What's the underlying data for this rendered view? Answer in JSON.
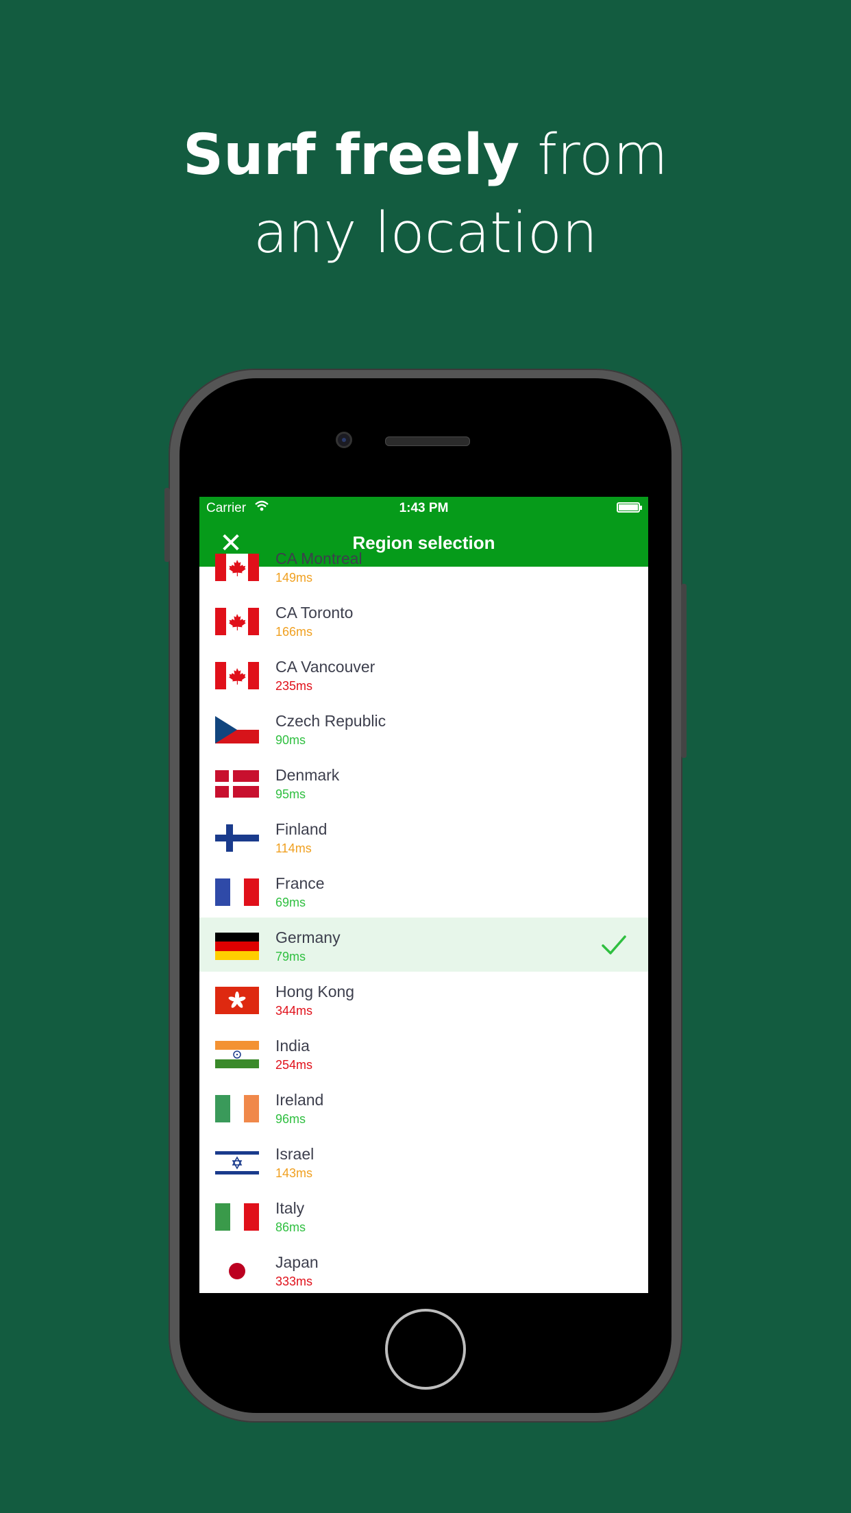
{
  "headline": {
    "bold": "Surf freely",
    "rest1": " from",
    "line2": "any location"
  },
  "status": {
    "carrier": "Carrier",
    "time": "1:43 PM"
  },
  "nav": {
    "title": "Region selection",
    "close_icon": "close-icon"
  },
  "colors": {
    "background": "#135c40",
    "accent": "#069b1a",
    "ping_good": "#2fbf40",
    "ping_mid": "#f0a020",
    "ping_bad": "#e0101a",
    "selected_row": "#e7f6ea"
  },
  "regions": [
    {
      "name": "CA Montreal",
      "ping": "149ms",
      "level": "mid",
      "flag": "canada-flag-icon"
    },
    {
      "name": "CA Toronto",
      "ping": "166ms",
      "level": "mid",
      "flag": "canada-flag-icon"
    },
    {
      "name": "CA Vancouver",
      "ping": "235ms",
      "level": "bad",
      "flag": "canada-flag-icon"
    },
    {
      "name": "Czech Republic",
      "ping": "90ms",
      "level": "good",
      "flag": "czech-flag-icon"
    },
    {
      "name": "Denmark",
      "ping": "95ms",
      "level": "good",
      "flag": "denmark-flag-icon"
    },
    {
      "name": "Finland",
      "ping": "114ms",
      "level": "mid",
      "flag": "finland-flag-icon"
    },
    {
      "name": "France",
      "ping": "69ms",
      "level": "good",
      "flag": "france-flag-icon"
    },
    {
      "name": "Germany",
      "ping": "79ms",
      "level": "good",
      "flag": "germany-flag-icon",
      "selected": true
    },
    {
      "name": "Hong Kong",
      "ping": "344ms",
      "level": "bad",
      "flag": "hong-kong-flag-icon"
    },
    {
      "name": "India",
      "ping": "254ms",
      "level": "bad",
      "flag": "india-flag-icon"
    },
    {
      "name": "Ireland",
      "ping": "96ms",
      "level": "good",
      "flag": "ireland-flag-icon"
    },
    {
      "name": "Israel",
      "ping": "143ms",
      "level": "mid",
      "flag": "israel-flag-icon"
    },
    {
      "name": "Italy",
      "ping": "86ms",
      "level": "good",
      "flag": "italy-flag-icon"
    },
    {
      "name": "Japan",
      "ping": "333ms",
      "level": "bad",
      "flag": "japan-flag-icon"
    }
  ]
}
